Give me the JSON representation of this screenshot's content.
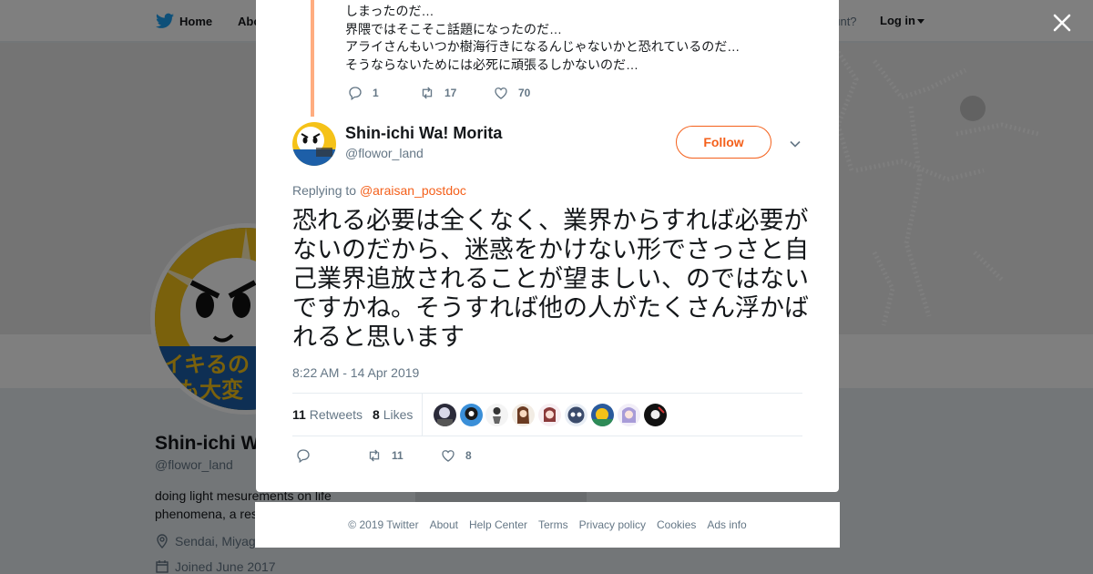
{
  "topbar": {
    "home": "Home",
    "about_partial": "Abo",
    "account_partial": "ccount?",
    "login": "Log in"
  },
  "profile": {
    "name_partial": "Shin-ichi W",
    "handle": "@flowor_land",
    "bio": "doing light mesurements on life phenomena, a res",
    "location_partial": "Sendai, Miyag",
    "joined": "Joined June 2017",
    "avatar_text_1": "イキるの",
    "avatar_text_2": "も大変"
  },
  "previous_tweet": {
    "lines": [
      "しまったのだ…",
      "界隈ではそこそこ話題になったのだ…",
      "アライさんもいつか樹海行きになるんじゃないかと恐れているのだ…",
      "そうならないためには必死に頑張るしかないのだ…"
    ],
    "replies": "1",
    "retweets": "17",
    "likes": "70"
  },
  "tweet": {
    "name": "Shin-ichi Wa! Morita",
    "handle": "@flowor_land",
    "follow_label": "Follow",
    "replying_prefix": "Replying to",
    "replying_to": "@araisan_postdoc",
    "text": "恐れる必要は全くなく、業界からすれば必要がないのだから、迷惑をかけない形でさっさと自己業界追放されることが望ましい、のではないですかね。そうすれば他の人がたくさん浮かばれると思います",
    "timestamp": "8:22 AM - 14 Apr 2019",
    "retweets_count": "11",
    "retweets_label": "Retweets",
    "likes_count": "8",
    "likes_label": "Likes",
    "action_retweets": "11",
    "action_likes": "8"
  },
  "footer": {
    "copyright": "© 2019 Twitter",
    "links": [
      "About",
      "Help Center",
      "Terms",
      "Privacy policy",
      "Cookies",
      "Ads info"
    ]
  },
  "colors": {
    "accent": "#f4601b",
    "thread_line": "#ffad80",
    "twitter_blue": "#1da1f2"
  }
}
